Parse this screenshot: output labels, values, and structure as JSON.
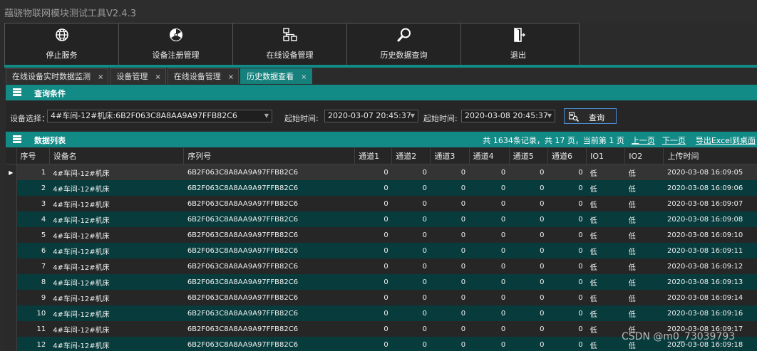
{
  "app": {
    "title": "蕴骁物联网模块测试工具V2.4.3"
  },
  "toolbar": [
    {
      "label": "停止服务",
      "icon": "globe-icon"
    },
    {
      "label": "设备注册管理",
      "icon": "radiation-icon"
    },
    {
      "label": "在线设备管理",
      "icon": "network-icon"
    },
    {
      "label": "历史数据查询",
      "icon": "magnifier-icon"
    },
    {
      "label": "退出",
      "icon": "exit-door-icon"
    }
  ],
  "tabs": [
    {
      "label": "在线设备实时数据监测",
      "close": "×",
      "active": false
    },
    {
      "label": "设备管理",
      "close": "×",
      "active": false
    },
    {
      "label": "在线设备管理",
      "close": "×",
      "active": false
    },
    {
      "label": "历史数据查看",
      "close": "×",
      "active": true
    }
  ],
  "query": {
    "section_title": "查询条件",
    "device_label": "设备选择：",
    "device_value": "4#车间-12#机床:6B2F063C8A8AA9A97FFB82C6",
    "start_label": "起始时间:",
    "start_value": "2020-03-07 20:45:37",
    "end_label": "起始时间:",
    "end_value": "2020-03-08 20:45:37",
    "button_label": "查询"
  },
  "list": {
    "section_title": "数据列表",
    "summary": "共 1634条记录，共 17 页，当前第 1 页",
    "prev_label": "上一页",
    "next_label": "下一页",
    "export_label": "导出Excel到桌面"
  },
  "table": {
    "columns": [
      "序号",
      "设备名",
      "序列号",
      "通道1",
      "通道2",
      "通道3",
      "通道4",
      "通道5",
      "通道6",
      "IO1",
      "IO2",
      "上传时间"
    ],
    "current_row_marker": "▶",
    "rows": [
      [
        "1",
        "4#车间-12#机床",
        "6B2F063C8A8AA9A97FFB82C6",
        "0",
        "0",
        "0",
        "0",
        "0",
        "0",
        "低",
        "低",
        "2020-03-08 16:09:05"
      ],
      [
        "2",
        "4#车间-12#机床",
        "6B2F063C8A8AA9A97FFB82C6",
        "0",
        "0",
        "0",
        "0",
        "0",
        "0",
        "低",
        "低",
        "2020-03-08 16:09:06"
      ],
      [
        "3",
        "4#车间-12#机床",
        "6B2F063C8A8AA9A97FFB82C6",
        "0",
        "0",
        "0",
        "0",
        "0",
        "0",
        "低",
        "低",
        "2020-03-08 16:09:07"
      ],
      [
        "4",
        "4#车间-12#机床",
        "6B2F063C8A8AA9A97FFB82C6",
        "0",
        "0",
        "0",
        "0",
        "0",
        "0",
        "低",
        "低",
        "2020-03-08 16:09:08"
      ],
      [
        "5",
        "4#车间-12#机床",
        "6B2F063C8A8AA9A97FFB82C6",
        "0",
        "0",
        "0",
        "0",
        "0",
        "0",
        "低",
        "低",
        "2020-03-08 16:09:10"
      ],
      [
        "6",
        "4#车间-12#机床",
        "6B2F063C8A8AA9A97FFB82C6",
        "0",
        "0",
        "0",
        "0",
        "0",
        "0",
        "低",
        "低",
        "2020-03-08 16:09:11"
      ],
      [
        "7",
        "4#车间-12#机床",
        "6B2F063C8A8AA9A97FFB82C6",
        "0",
        "0",
        "0",
        "0",
        "0",
        "0",
        "低",
        "低",
        "2020-03-08 16:09:12"
      ],
      [
        "8",
        "4#车间-12#机床",
        "6B2F063C8A8AA9A97FFB82C6",
        "0",
        "0",
        "0",
        "0",
        "0",
        "0",
        "低",
        "低",
        "2020-03-08 16:09:13"
      ],
      [
        "9",
        "4#车间-12#机床",
        "6B2F063C8A8AA9A97FFB82C6",
        "0",
        "0",
        "0",
        "0",
        "0",
        "0",
        "低",
        "低",
        "2020-03-08 16:09:14"
      ],
      [
        "10",
        "4#车间-12#机床",
        "6B2F063C8A8AA9A97FFB82C6",
        "0",
        "0",
        "0",
        "0",
        "0",
        "0",
        "低",
        "低",
        "2020-03-08 16:09:16"
      ],
      [
        "11",
        "4#车间-12#机床",
        "6B2F063C8A8AA9A97FFB82C6",
        "0",
        "0",
        "0",
        "0",
        "0",
        "0",
        "低",
        "低",
        "2020-03-08 16:09:17"
      ],
      [
        "12",
        "4#车间-12#机床",
        "6B2F063C8A8AA9A97FFB82C6",
        "0",
        "0",
        "0",
        "0",
        "0",
        "0",
        "低",
        "低",
        "2020-03-08 16:09:18"
      ]
    ]
  },
  "watermark": "CSDN @m0_73039793",
  "colors": {
    "accent": "#128a86",
    "row_alt": "#083b3c",
    "background": "#2b2b2b"
  }
}
